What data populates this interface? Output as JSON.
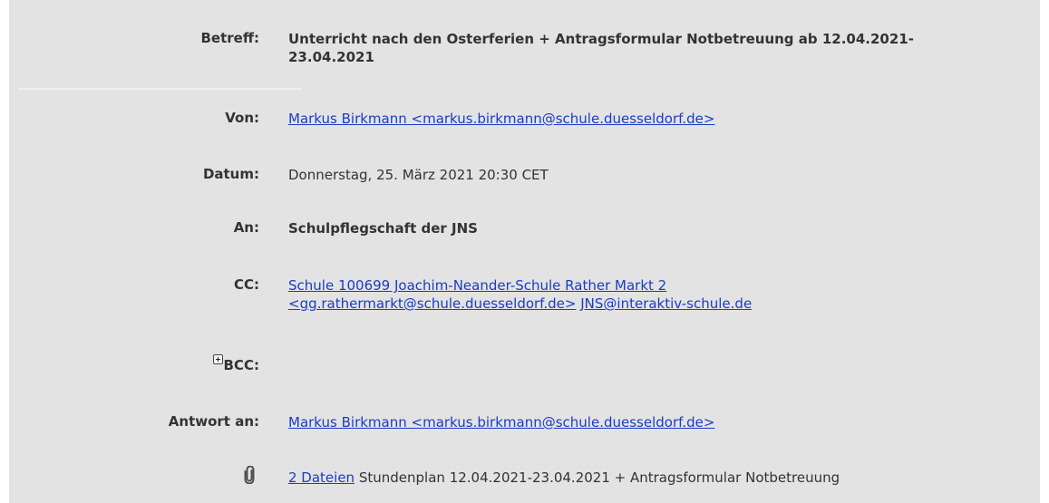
{
  "header": {
    "subject": {
      "label": "Betreff:",
      "value": "Unterricht nach den Osterferien + Antragsformular Notbetreuung ab 12.04.2021-23.04.2021"
    },
    "from": {
      "label": "Von:",
      "value": "Markus Birkmann <markus.birkmann@schule.duesseldorf.de>"
    },
    "date": {
      "label": "Datum:",
      "value": "Donnerstag, 25. März 2021 20:30 CET"
    },
    "to": {
      "label": "An:",
      "value": "Schulpflegschaft der JNS"
    },
    "cc": {
      "label": "CC:",
      "recipient1": "Schule 100699 Joachim-Neander-Schule Rather Markt 2 <gg.rathermarkt@schule.duesseldorf.de>",
      "recipient2": "JNS@interaktiv-schule.de"
    },
    "bcc": {
      "label": "BCC:"
    },
    "reply_to": {
      "label": "Antwort an:",
      "value": "Markus Birkmann <markus.birkmann@schule.duesseldorf.de>"
    },
    "attachments": {
      "icon": "paperclip-icon",
      "count_label": "2 Dateien",
      "description": "Stundenplan 12.04.2021-23.04.2021 + Antragsformular Notbetreuung"
    }
  },
  "colors": {
    "background": "#e3e3e3",
    "link": "#1a3cc8",
    "text": "#333333"
  }
}
